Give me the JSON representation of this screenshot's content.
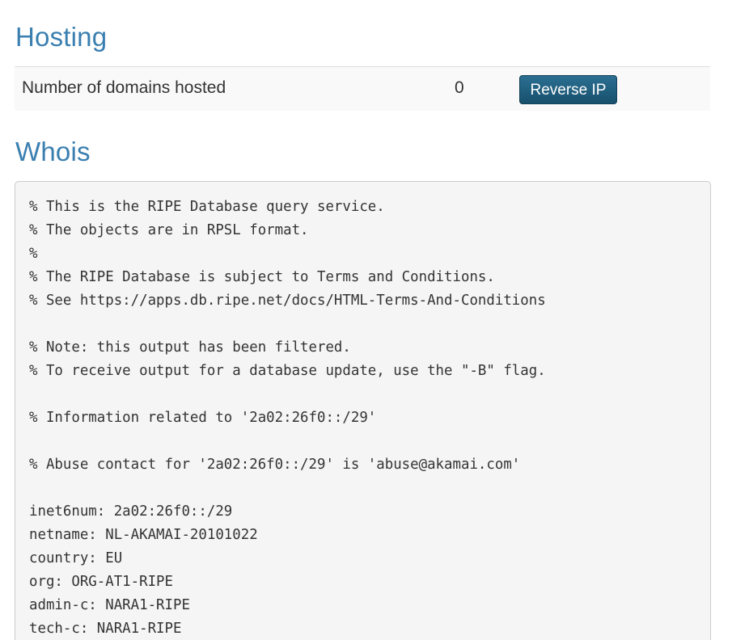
{
  "hosting": {
    "title": "Hosting",
    "label": "Number of domains hosted",
    "count": "0",
    "button_label": "Reverse IP"
  },
  "whois": {
    "title": "Whois",
    "lines": [
      "% This is the RIPE Database query service.",
      "% The objects are in RPSL format.",
      "%",
      "% The RIPE Database is subject to Terms and Conditions.",
      "% See https://apps.db.ripe.net/docs/HTML-Terms-And-Conditions",
      "",
      "% Note: this output has been filtered.",
      "% To receive output for a database update, use the \"-B\" flag.",
      "",
      "% Information related to '2a02:26f0::/29'",
      "",
      "% Abuse contact for '2a02:26f0::/29' is 'abuse@akamai.com'",
      "",
      "inet6num: 2a02:26f0::/29",
      "netname: NL-AKAMAI-20101022",
      "country: EU",
      "org: ORG-AT1-RIPE",
      "admin-c: NARA1-RIPE",
      "tech-c: NARA1-RIPE"
    ]
  }
}
